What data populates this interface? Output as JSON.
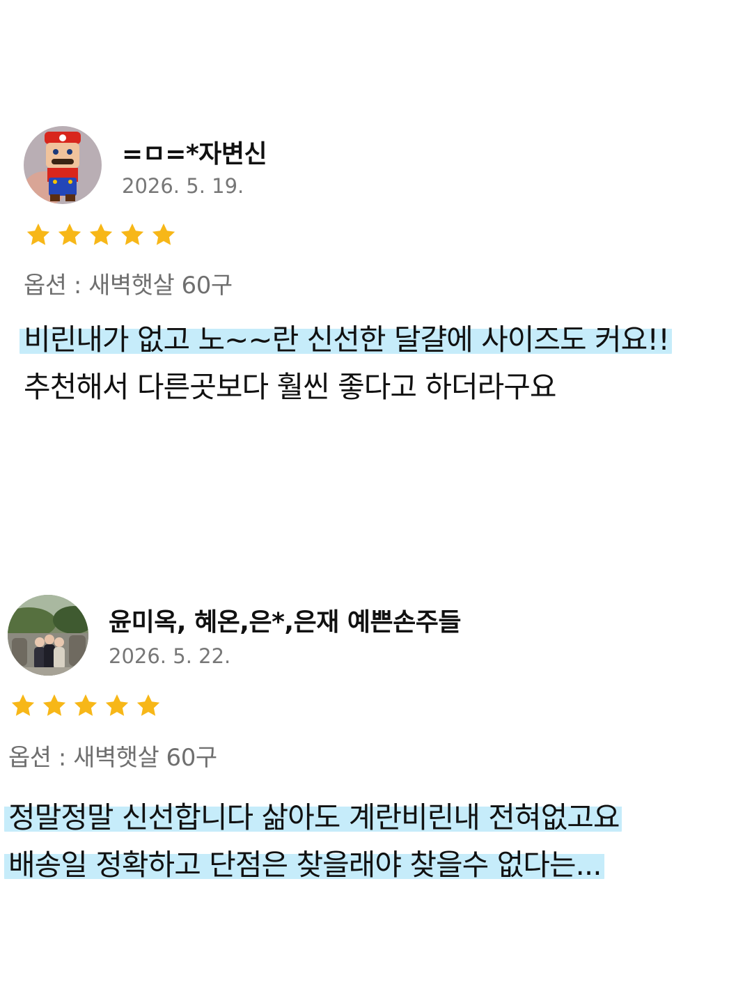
{
  "reviews": [
    {
      "author": "=ㅁ=*자변신",
      "date": "2026. 5. 19.",
      "rating": 5,
      "option": "옵션 : 새벽햇살 60구",
      "lines": [
        "비린내가 없고 노~~란 신선한 달걀에 사이즈도 커요!!",
        "추천해서 다른곳보다 훨씬 좋다고 하더라구요"
      ],
      "highlighted_lines": [
        0
      ]
    },
    {
      "author": "윤미옥, 혜온,은*,은재 예쁜손주들",
      "date": "2026. 5. 22.",
      "rating": 5,
      "option": "옵션 : 새벽햇살 60구",
      "lines": [
        "정말정말 신선합니다 삶아도 계란비린내 전혀없고요",
        "배송일 정확하고 단점은 찾을래야 찾을수 없다는..."
      ],
      "highlighted_lines": [
        0,
        1
      ]
    }
  ],
  "colors": {
    "star": "#f7b718",
    "highlight": "#c6ecfa"
  }
}
